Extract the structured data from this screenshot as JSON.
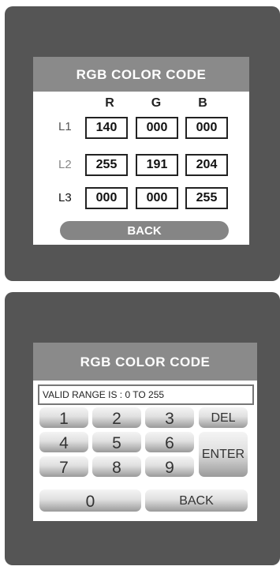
{
  "rgb_screen": {
    "title": "RGB COLOR CODE",
    "columns": [
      "R",
      "G",
      "B"
    ],
    "rows": [
      {
        "label": "L1",
        "label_color": "#555555",
        "values": [
          "140",
          "000",
          "000"
        ]
      },
      {
        "label": "L2",
        "label_color": "#888888",
        "values": [
          "255",
          "191",
          "204"
        ]
      },
      {
        "label": "L3",
        "label_color": "#111111",
        "values": [
          "000",
          "000",
          "255"
        ]
      }
    ],
    "back_label": "BACK"
  },
  "keypad_screen": {
    "title": "RGB COLOR CODE",
    "range_text": "VALID RANGE IS : 0 TO 255",
    "keys": {
      "k1": "1",
      "k2": "2",
      "k3": "3",
      "k4": "4",
      "k5": "5",
      "k6": "6",
      "k7": "7",
      "k8": "8",
      "k9": "9",
      "k0": "0",
      "del": "DEL",
      "enter": "ENTER",
      "back": "BACK"
    }
  },
  "colors": {
    "panel": "#555555",
    "title_bar": "#8a8a8a",
    "back_button": "#858585"
  }
}
